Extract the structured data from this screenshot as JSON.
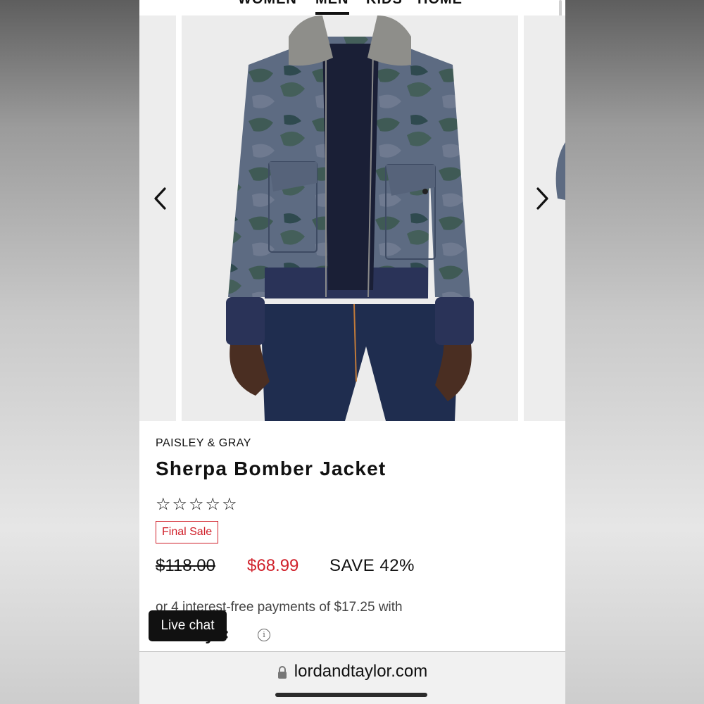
{
  "nav": {
    "items": [
      "WOMEN",
      "MEN",
      "KIDS",
      "HOME"
    ],
    "active": "MEN"
  },
  "carousel": {
    "prev_icon": "chevron-left-icon",
    "next_icon": "chevron-right-icon",
    "zoom_icon": "magnifier-icon"
  },
  "product": {
    "brand": "PAISLEY & GRAY",
    "title": "Sherpa Bomber Jacket",
    "rating": {
      "value": 0,
      "max": 5
    },
    "badge": "Final Sale",
    "price_original": "$118.00",
    "price_sale": "$68.99",
    "savings": "SAVE 42%",
    "installments": "or 4 interest-free payments of $17.25 with",
    "installments_provider": "ay"
  },
  "live_chat": {
    "label": "Live chat"
  },
  "browser": {
    "url": "lordandtaylor.com"
  },
  "colors": {
    "sale_red": "#d0202a",
    "text": "#111111"
  }
}
